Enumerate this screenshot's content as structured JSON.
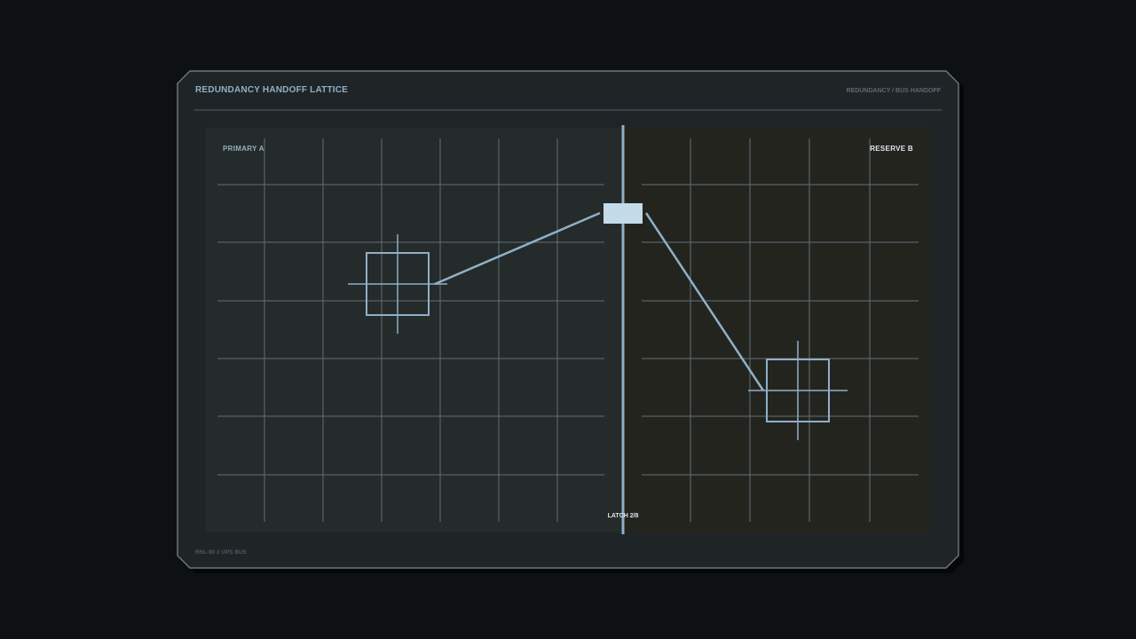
{
  "header": {
    "title": "REDUNDANCY HANDOFF LATTICE",
    "breadcrumb": "REDUNDANCY / BUS HANDOFF"
  },
  "zones": {
    "primary_label": "PRIMARY  A",
    "reserve_label": "RESERVE  B"
  },
  "latch": {
    "readout": "LATCH 2/8",
    "position": 2,
    "total": 8
  },
  "footer": {
    "code": "RHL-90 // UPS BUS"
  },
  "colors": {
    "background": "#0e1111",
    "panel": "#1f2526",
    "panel_border": "#7d8a8d",
    "grid_line": "#5f7078",
    "accent_line": "#8fb0c8",
    "primary_zone": "#252a2a",
    "reserve_zone": "#24241f",
    "latch_fill": "#c4dbe8"
  }
}
